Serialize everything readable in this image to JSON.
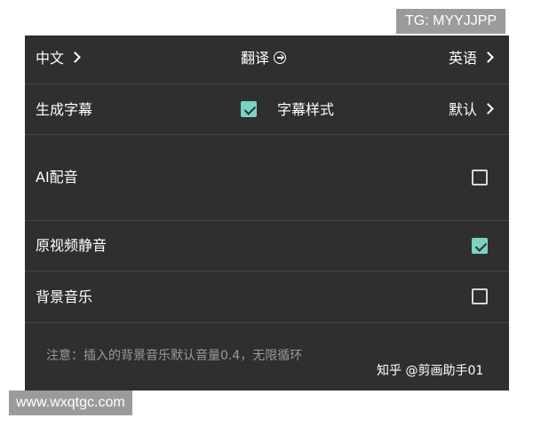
{
  "watermarks": {
    "top_tag": "TG: MYYJJPP",
    "bottom_tag": "www.wxqtgc.com",
    "zhihu": "知乎 @剪画助手01"
  },
  "translation_row": {
    "source_language": "中文",
    "translate_label": "翻译",
    "target_language": "英语"
  },
  "subtitle_row": {
    "generate_label": "生成字幕",
    "generate_checked": true,
    "style_label": "字幕样式",
    "style_value": "默认"
  },
  "options": [
    {
      "label": "AI配音",
      "checked": false
    },
    {
      "label": "原视频静音",
      "checked": true
    },
    {
      "label": "背景音乐",
      "checked": false
    }
  ],
  "note": "注意：插入的背景音乐默认音量0.4，无限循环",
  "colors": {
    "panel_bg": "#2f2f2f",
    "check_accent": "#7ad3c2",
    "note_text": "#9a9a9a"
  }
}
